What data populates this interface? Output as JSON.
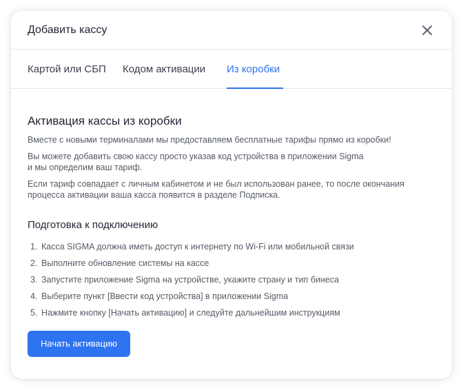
{
  "dialog": {
    "title": "Добавить кассу",
    "close_icon": "close-icon"
  },
  "tabs": [
    {
      "label": "Картой или СБП",
      "active": false
    },
    {
      "label": "Кодом активации",
      "active": false
    },
    {
      "label": "Из коробки",
      "active": true
    }
  ],
  "section": {
    "title": "Активация кассы из коробки",
    "paragraph1": "Вместе с новыми терминалами мы предоставляем бесплатные тарифы прямо из коробки!",
    "paragraph2_line1": "Вы можете добавить свою кассу просто указав код устройства в приложении Sigma",
    "paragraph2_line2": "и мы определим ваш тариф.",
    "paragraph3_line1": "Если тариф совпадает с личным кабинетом и не был использован ранее, то после окончания",
    "paragraph3_line2": "процесса активации ваша касса появится в разделе Подписка."
  },
  "preparation": {
    "title": "Подготовка к подключению",
    "steps": [
      {
        "num": "1.",
        "text": "Касса SIGMA должна иметь доступ к интернету по Wi-Fi или мобильной связи"
      },
      {
        "num": "2.",
        "text": "Выполните обновление системы на кассе"
      },
      {
        "num": "3.",
        "text": "Запустите приложение Sigma на устройстве, укажите страну и тип бинеса"
      },
      {
        "num": "4.",
        "text": "Выберите пункт [Ввести код устройства] в приложении Sigma"
      },
      {
        "num": "5.",
        "text": "Нажмите кнопку [Начать активацию] и следуйте дальнейшим инструкциям"
      }
    ]
  },
  "actions": {
    "activate_label": "Начать активацию"
  },
  "colors": {
    "accent": "#2e73e8",
    "button": "#2e73f0",
    "title_text": "#1f2433",
    "body_text": "#555b66",
    "divider": "#e4e6ea"
  }
}
